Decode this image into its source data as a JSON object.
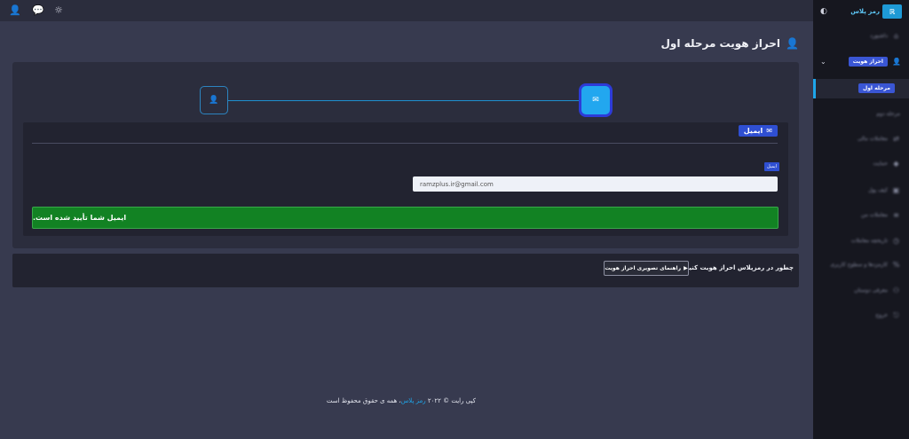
{
  "topbar": {
    "icons": [
      "user-settings-icon",
      "chat-icon",
      "sun-icon"
    ]
  },
  "sidebar": {
    "logo_text": "رمز پلاس",
    "items": [
      {
        "label": "داشبورد",
        "icon": "home-icon"
      },
      {
        "label": "احراز هویت",
        "icon": "user-check-icon"
      },
      {
        "label": "مرحله اول",
        "icon": ""
      },
      {
        "label": "مرحله دوم",
        "icon": ""
      },
      {
        "label": "معاملات مالی",
        "icon": "exchange-icon"
      },
      {
        "label": "حمایت",
        "icon": "tag-icon"
      },
      {
        "label": "کیف پول",
        "icon": "wallet-icon"
      },
      {
        "label": "معاملات من",
        "icon": "list-icon"
      },
      {
        "label": "تاریخچه معاملات",
        "icon": "history-icon"
      },
      {
        "label": "کارمزدها و سطوح کاربری",
        "icon": "percent-icon"
      },
      {
        "label": "معرفی دوستان",
        "icon": "users-icon"
      },
      {
        "label": "خروج",
        "icon": "logout-icon"
      }
    ]
  },
  "main": {
    "page_title": "احراز هویت مرحله اول",
    "section_title": "ایمیل",
    "field_label": "ایمیل",
    "email_value": "ramzplus.ir@gmail.com",
    "success_message": "ایمیل شما تأیید شده است.",
    "help_question": "چطور در رمزپلاس احراز هویت کنیم؟",
    "help_button": "راهنمای تصویری احراز هویت"
  },
  "footer": {
    "copyright_prefix": "کپی رایت © ۲۰۲۲",
    "brand": "رمز پلاس",
    "copyright_suffix": "، همه ی حقوق محفوظ است"
  }
}
